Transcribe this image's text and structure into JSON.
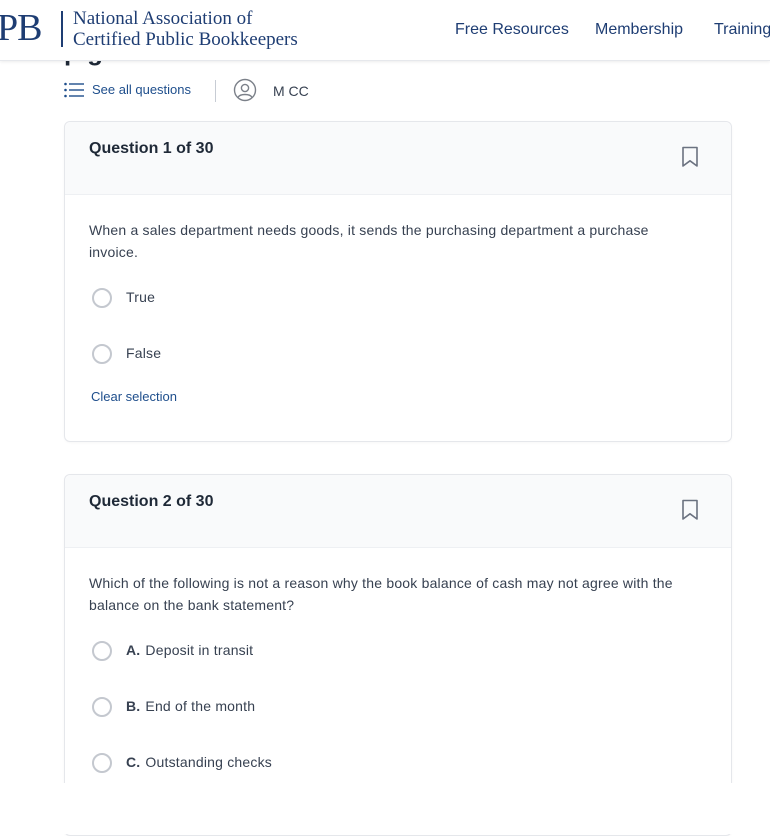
{
  "header": {
    "logo_mark": "PB",
    "logo_line1": "National Association of",
    "logo_line2": "Certified Public Bookkeepers",
    "nav": [
      "Free Resources",
      "Membership",
      "Training"
    ]
  },
  "page": {
    "title_fragment": "p g"
  },
  "toolbar": {
    "see_all_label": "See all questions",
    "list_icon": "list-icon",
    "user_icon": "user-circle-icon",
    "user_name": "M CC"
  },
  "questions": [
    {
      "title": "Question 1 of 30",
      "text": "When a sales department needs goods, it sends the purchasing department a purchase invoice.",
      "options": [
        {
          "letter": "",
          "label": "True"
        },
        {
          "letter": "",
          "label": "False"
        }
      ],
      "clear_label": "Clear selection"
    },
    {
      "title": "Question 2 of 30",
      "text": "Which of the following is not a reason why the book balance of cash may not agree with the balance on the bank statement?",
      "options": [
        {
          "letter": "A.",
          "label": "Deposit in transit"
        },
        {
          "letter": "B.",
          "label": "End of the month"
        },
        {
          "letter": "C.",
          "label": "Outstanding checks"
        }
      ]
    }
  ],
  "colors": {
    "brand_navy": "#1e3d73",
    "link_blue": "#1e4e8c",
    "card_header_bg": "#f9fafb",
    "radio_border": "#c4c8cf"
  }
}
